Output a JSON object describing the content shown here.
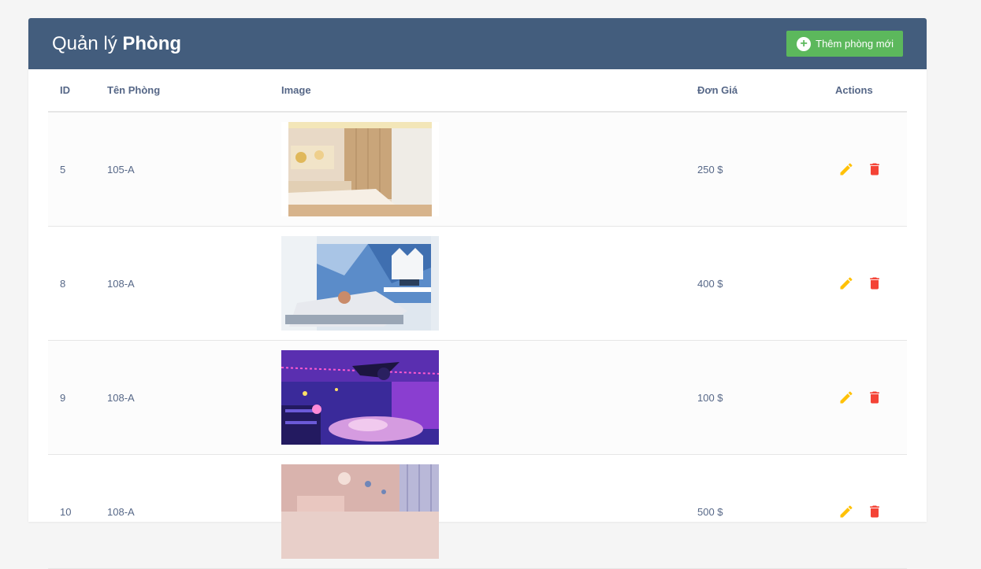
{
  "header": {
    "title_prefix": "Quản lý",
    "title_bold": "Phòng",
    "add_button_label": "Thêm phòng mới"
  },
  "table": {
    "columns": [
      "ID",
      "Tên Phòng",
      "Image",
      "Đơn Giá",
      "Actions"
    ],
    "rows": [
      {
        "id": "5",
        "name": "105-A",
        "price": "250 $",
        "image": "room-beige-bedroom"
      },
      {
        "id": "8",
        "name": "108-A",
        "price": "400 $",
        "image": "room-blue-kids-bedroom"
      },
      {
        "id": "9",
        "name": "108-A",
        "price": "100 $",
        "image": "room-purple-neon-bedroom"
      },
      {
        "id": "10",
        "name": "108-A",
        "price": "500 $",
        "image": "room-pink-bedroom"
      }
    ]
  },
  "icons": {
    "add": "plus-circle-icon",
    "edit": "pencil-icon",
    "delete": "trash-icon"
  },
  "colors": {
    "header_bg": "#435d7d",
    "add_button": "#5cb85c",
    "edit_icon": "#ffc107",
    "delete_icon": "#f44336",
    "text": "#566787"
  }
}
